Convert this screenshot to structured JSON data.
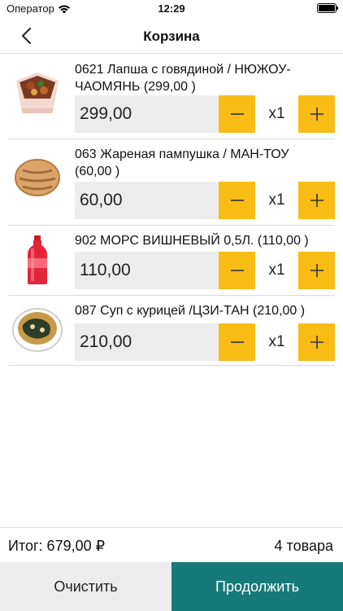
{
  "status": {
    "carrier": "Оператор",
    "time": "12:29"
  },
  "nav": {
    "title": "Корзина"
  },
  "items": [
    {
      "title": "0621 Лапша с говядиной / НЮЖОУ-ЧАОМЯНЬ (299,00 )",
      "price": "299,00",
      "qty": "x1",
      "thumb_icon": "noodles-box-icon"
    },
    {
      "title": "063 Жареная пампушка / МАН-ТОУ (60,00 )",
      "price": "60,00",
      "qty": "x1",
      "thumb_icon": "fried-bun-icon"
    },
    {
      "title": "902 МОРС ВИШНЕВЫЙ 0,5Л. (110,00 )",
      "price": "110,00",
      "qty": "x1",
      "thumb_icon": "bottle-icon"
    },
    {
      "title": "087 Суп с курицей /ЦЗИ-ТАН (210,00 )",
      "price": "210,00",
      "qty": "x1",
      "thumb_icon": "soup-bowl-icon"
    }
  ],
  "summary": {
    "total": "Итог: 679,00 ₽",
    "count": "4 товара"
  },
  "buttons": {
    "clear": "Очистить",
    "continue": "Продолжить"
  },
  "colors": {
    "accent": "#f9bc15",
    "primary": "#177a7a",
    "field_bg": "#ececec"
  }
}
